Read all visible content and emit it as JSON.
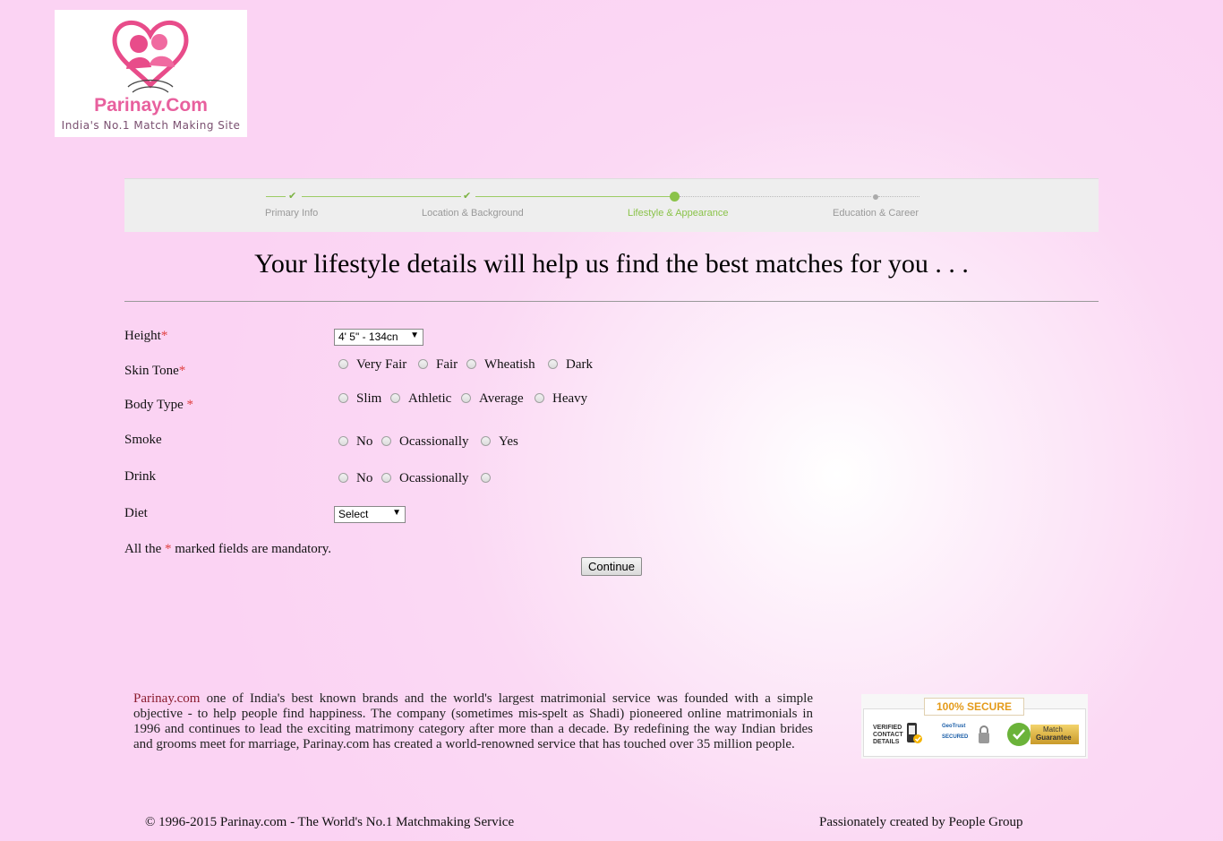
{
  "brand": {
    "name": "Parinay.Com",
    "tagline": "India's No.1 Match Making Site"
  },
  "progress": {
    "steps": [
      {
        "label": "Primary Info",
        "state": "done"
      },
      {
        "label": "Location & Background",
        "state": "done"
      },
      {
        "label": "Lifestyle & Appearance",
        "state": "active"
      },
      {
        "label": "Education & Career",
        "state": "pending"
      }
    ]
  },
  "headline": "Your lifestyle details will help us find the best matches for you . . .",
  "form": {
    "height": {
      "label": "Height",
      "required_mark": "*",
      "value": "4' 5\" - 134cn"
    },
    "skin_tone": {
      "label": "Skin Tone",
      "required_mark": "*",
      "options": [
        "Very Fair",
        "Fair",
        "Wheatish",
        "Dark"
      ]
    },
    "body_type": {
      "label": "Body Type",
      "required_mark": "*",
      "options": [
        "Slim",
        "Athletic",
        "Average",
        "Heavy"
      ]
    },
    "smoke": {
      "label": "Smoke",
      "options": [
        "No",
        "Ocassionally",
        "Yes"
      ]
    },
    "drink": {
      "label": "Drink",
      "options": [
        "No",
        "Ocassionally"
      ]
    },
    "diet": {
      "label": "Diet",
      "value": "Select"
    },
    "mandatory_note": {
      "before": "All the",
      "mark": "*",
      "after": "marked fields are mandatory."
    },
    "continue_label": "Continue"
  },
  "about": {
    "brand": "Parinay.com",
    "text": "one of India's best known brands and the world's largest matrimonial service was founded with a simple objective - to help people find happiness. The company (sometimes mis-spelt as Shadi) pioneered online matrimonials in 1996 and continues to lead the exciting matrimony category after more than a decade. By redefining the way Indian brides and grooms meet for marriage, Parinay.com has created a world-renowned service that has touched over 35 million people."
  },
  "secure": {
    "title": "100% SECURE",
    "verified": [
      "VERIFIED",
      "CONTACT",
      "DETAILS"
    ],
    "geotrust": "GeoTrust",
    "secured": "SECURED",
    "guarantee": [
      "Match",
      "Guarantee"
    ]
  },
  "footer": {
    "copyright": "© 1996-2015 Parinay.com - The World's No.1 Matchmaking Service",
    "credit": "Passionately created by People Group"
  },
  "colors": {
    "accent_green": "#8bc34a",
    "required_red": "#e04040",
    "logo_pink": "#e8609e"
  }
}
